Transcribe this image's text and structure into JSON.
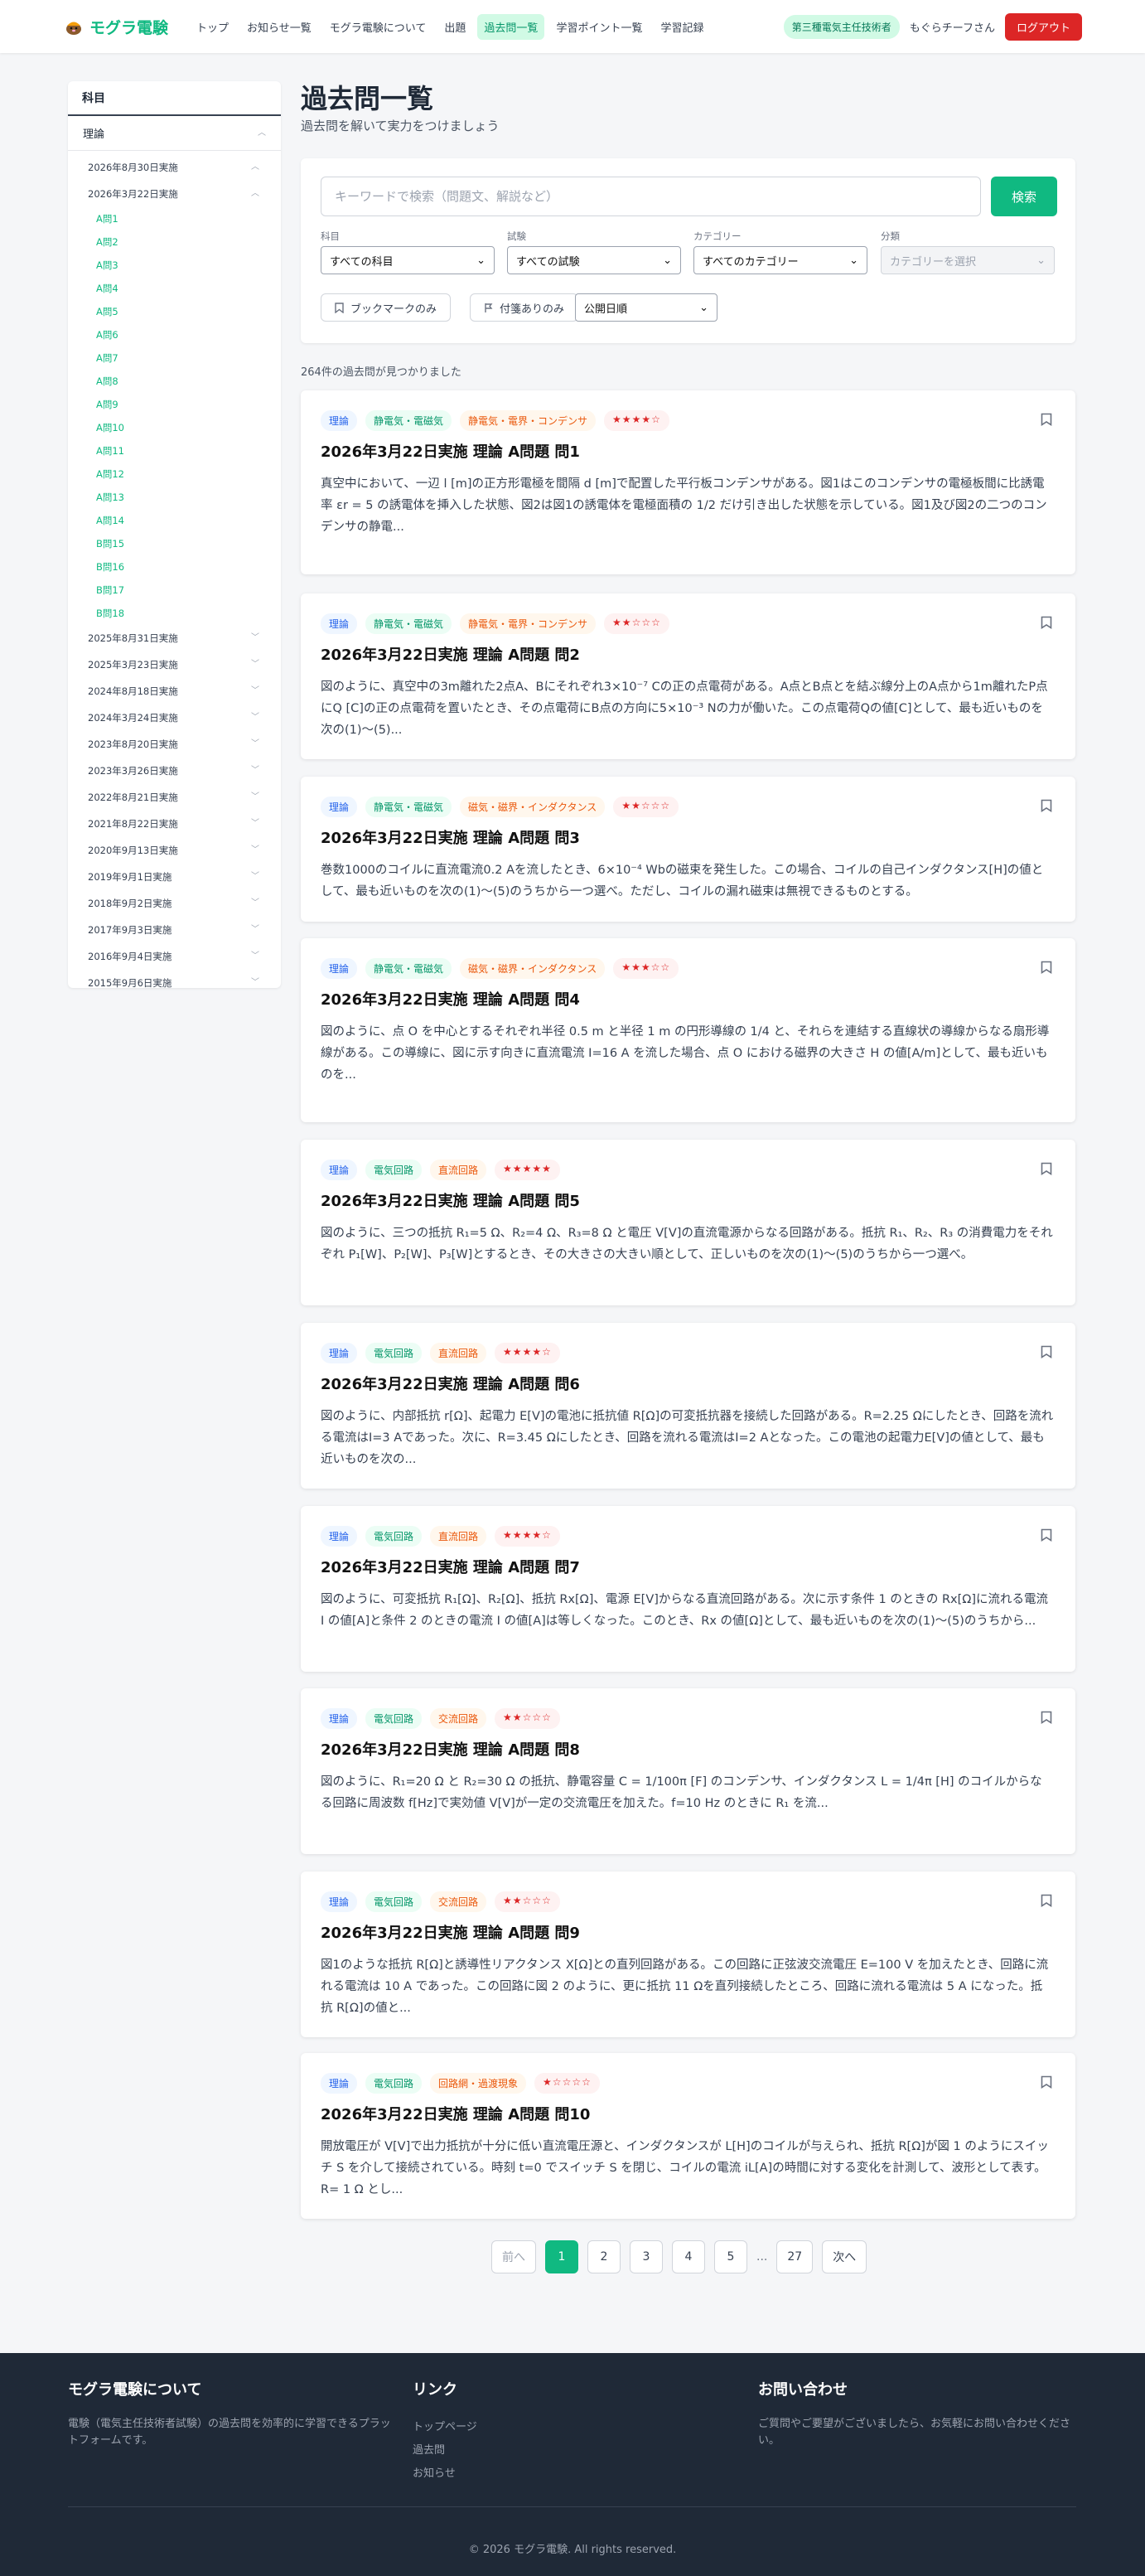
{
  "header": {
    "logo": "モグラ電験",
    "nav": [
      "トップ",
      "お知らせ一覧",
      "モグラ電験について",
      "出題",
      "過去問一覧",
      "学習ポイント一覧",
      "学習記録"
    ],
    "active_nav": "過去問一覧",
    "license_badge": "第三種電気主任技術者",
    "user": "もぐらチーフさん",
    "logout": "ログアウト"
  },
  "sidebar": {
    "heading": "科目",
    "subject": "理論",
    "exams_top": [
      {
        "label": "2026年8月30日実施",
        "open": true
      },
      {
        "label": "2026年3月22日実施",
        "open": true
      }
    ],
    "questions": [
      "A問1",
      "A問2",
      "A問3",
      "A問4",
      "A問5",
      "A問6",
      "A問7",
      "A問8",
      "A問9",
      "A問10",
      "A問11",
      "A問12",
      "A問13",
      "A問14",
      "B問15",
      "B問16",
      "B問17",
      "B問18"
    ],
    "exams_rest": [
      "2025年8月31日実施",
      "2025年3月23日実施",
      "2024年8月18日実施",
      "2024年3月24日実施",
      "2023年8月20日実施",
      "2023年3月26日実施",
      "2022年8月21日実施",
      "2021年8月22日実施",
      "2020年9月13日実施",
      "2019年9月1日実施",
      "2018年9月2日実施",
      "2017年9月3日実施",
      "2016年9月4日実施",
      "2015年9月6日実施"
    ]
  },
  "main": {
    "title": "過去問一覧",
    "subtitle": "過去問を解いて実力をつけましょう",
    "count": "264件の過去問が見つかりました"
  },
  "search": {
    "placeholder": "キーワードで検索（問題文、解説など）",
    "button": "検索",
    "filters": [
      {
        "label": "科目",
        "value": "すべての科目"
      },
      {
        "label": "試験",
        "value": "すべての試験"
      },
      {
        "label": "カテゴリー",
        "value": "すべてのカテゴリー"
      },
      {
        "label": "分類",
        "value": "カテゴリーを選択"
      }
    ],
    "bookmark_only": "ブックマークのみ",
    "sticky_only": "付箋ありのみ",
    "sort": "公開日順"
  },
  "cards": [
    {
      "subject": "理論",
      "category": "静電気・電磁気",
      "sub": "静電気・電界・コンデンサ",
      "stars": "★★★★☆",
      "title": "2026年3月22日実施 理論 A問題 問1",
      "body": "真空中において、一辺 l [m]の正方形電極を間隔 d [m]で配置した平行板コンデンサがある。図1はこのコンデンサの電極板間に比誘電率 εr = 5 の誘電体を挿入した状態、図2は図1の誘電体を電極面積の 1/2 だけ引き出した状態を示している。図1及び図2の二つのコンデンサの静電..."
    },
    {
      "subject": "理論",
      "category": "静電気・電磁気",
      "sub": "静電気・電界・コンデンサ",
      "stars": "★★☆☆☆",
      "title": "2026年3月22日実施 理論 A問題 問2",
      "body": "図のように、真空中の3m離れた2点A、Bにそれぞれ3×10⁻⁷ Cの正の点電荷がある。A点とB点とを結ぶ線分上のA点から1m離れたP点にQ [C]の正の点電荷を置いたとき、その点電荷にB点の方向に5×10⁻³ Nの力が働いた。この点電荷Qの値[C]として、最も近いものを次の(1)〜(5)..."
    },
    {
      "subject": "理論",
      "category": "静電気・電磁気",
      "sub": "磁気・磁界・インダクタンス",
      "stars": "★★☆☆☆",
      "title": "2026年3月22日実施 理論 A問題 問3",
      "body": "巻数1000のコイルに直流電流0.2 Aを流したとき、6×10⁻⁴ Wbの磁束を発生した。この場合、コイルの自己インダクタンス[H]の値として、最も近いものを次の(1)〜(5)のうちから一つ選べ。ただし、コイルの漏れ磁束は無視できるものとする。"
    },
    {
      "subject": "理論",
      "category": "静電気・電磁気",
      "sub": "磁気・磁界・インダクタンス",
      "stars": "★★★☆☆",
      "title": "2026年3月22日実施 理論 A問題 問4",
      "body": "図のように、点 O を中心とするそれぞれ半径 0.5 m と半径 1 m の円形導線の 1/4 と、それらを連結する直線状の導線からなる扇形導線がある。この導線に、図に示す向きに直流電流 I=16 A を流した場合、点 O における磁界の大きさ H の値[A/m]として、最も近いものを..."
    },
    {
      "subject": "理論",
      "category": "電気回路",
      "sub": "直流回路",
      "stars": "★★★★★",
      "title": "2026年3月22日実施 理論 A問題 問5",
      "body": "図のように、三つの抵抗 R₁=5 Ω、R₂=4 Ω、R₃=8 Ω と電圧 V[V]の直流電源からなる回路がある。抵抗 R₁、R₂、R₃ の消費電力をそれぞれ P₁[W]、P₂[W]、P₃[W]とするとき、その大きさの大きい順として、正しいものを次の(1)〜(5)のうちから一つ選べ。"
    },
    {
      "subject": "理論",
      "category": "電気回路",
      "sub": "直流回路",
      "stars": "★★★★☆",
      "title": "2026年3月22日実施 理論 A問題 問6",
      "body": "図のように、内部抵抗 r[Ω]、起電力 E[V]の電池に抵抗値 R[Ω]の可変抵抗器を接続した回路がある。R=2.25 Ωにしたとき、回路を流れる電流はI=3 Aであった。次に、R=3.45 Ωにしたとき、回路を流れる電流はI=2 Aとなった。この電池の起電力E[V]の値として、最も近いものを次の..."
    },
    {
      "subject": "理論",
      "category": "電気回路",
      "sub": "直流回路",
      "stars": "★★★★☆",
      "title": "2026年3月22日実施 理論 A問題 問7",
      "body": "図のように、可変抵抗 R₁[Ω]、R₂[Ω]、抵抗 Rx[Ω]、電源 E[V]からなる直流回路がある。次に示す条件 1 のときの Rx[Ω]に流れる電流 I の値[A]と条件 2 のときの電流 I の値[A]は等しくなった。このとき、Rx の値[Ω]として、最も近いものを次の(1)〜(5)のうちから..."
    },
    {
      "subject": "理論",
      "category": "電気回路",
      "sub": "交流回路",
      "stars": "★★☆☆☆",
      "title": "2026年3月22日実施 理論 A問題 問8",
      "body": "図のように、R₁=20 Ω と R₂=30 Ω の抵抗、静電容量 C = 1/100π [F] のコンデンサ、インダクタンス L = 1/4π [H] のコイルからなる回路に周波数 f[Hz]で実効値 V[V]が一定の交流電圧を加えた。f=10 Hz のときに R₁ を流..."
    },
    {
      "subject": "理論",
      "category": "電気回路",
      "sub": "交流回路",
      "stars": "★★☆☆☆",
      "title": "2026年3月22日実施 理論 A問題 問9",
      "body": "図1のような抵抗 R[Ω]と誘導性リアクタンス X[Ω]との直列回路がある。この回路に正弦波交流電圧 E=100 V を加えたとき、回路に流れる電流は 10 A であった。この回路に図 2 のように、更に抵抗 11 Ωを直列接続したところ、回路に流れる電流は 5 A になった。抵抗 R[Ω]の値と..."
    },
    {
      "subject": "理論",
      "category": "電気回路",
      "sub": "回路網・過渡現象",
      "stars": "★☆☆☆☆",
      "title": "2026年3月22日実施 理論 A問題 問10",
      "body": "開放電圧が V[V]で出力抵抗が十分に低い直流電圧源と、インダクタンスが L[H]のコイルが与えられ、抵抗 R[Ω]が図 1 のようにスイッチ S を介して接続されている。時刻 t=0 でスイッチ S を閉じ、コイルの電流 iL[A]の時間に対する変化を計測して、波形として表す。R= 1 Ω とし..."
    }
  ],
  "pagination": {
    "prev": "前へ",
    "pages": [
      "1",
      "2",
      "3",
      "4",
      "5"
    ],
    "ellipsis": "...",
    "last": "27",
    "next": "次へ",
    "current": "1"
  },
  "footer": {
    "about_h": "モグラ電験について",
    "about_t": "電験（電気主任技術者試験）の過去問を効率的に学習できるプラットフォームです。",
    "links_h": "リンク",
    "links": [
      "トップページ",
      "過去問",
      "お知らせ"
    ],
    "contact_h": "お問い合わせ",
    "contact_t": "ご質問やご要望がございましたら、お気軽にお問い合わせください。",
    "copyright": "© 2026 モグラ電験. All rights reserved."
  },
  "colors": {
    "accent": "#10b981",
    "logout": "#dc2626",
    "footer": "#1f2937"
  }
}
